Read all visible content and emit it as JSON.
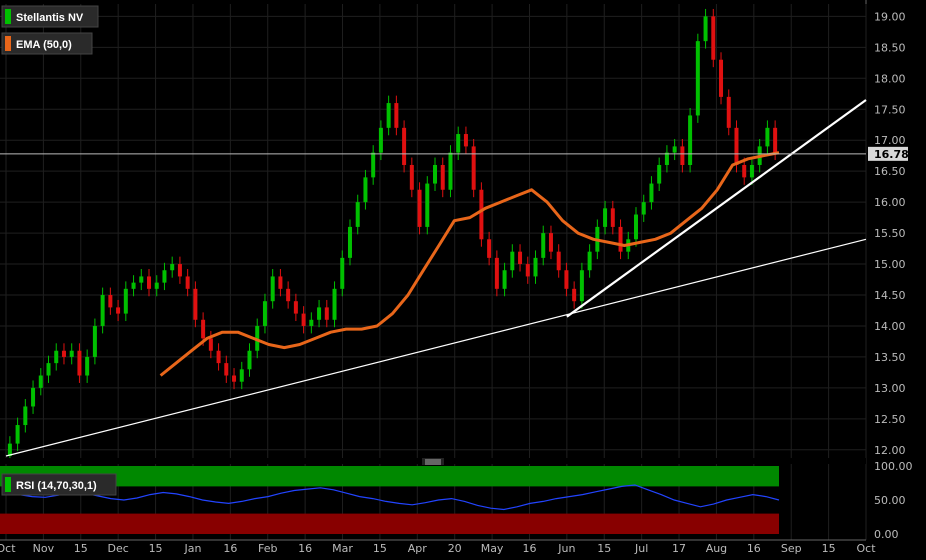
{
  "legend": {
    "symbol": "Stellantis NV",
    "symbol_color": "#00c000",
    "ema": "EMA (50,0)",
    "ema_color": "#e8661a",
    "rsi": "RSI (14,70,30,1)",
    "rsi_color": "#00c000"
  },
  "last_price_label": "16.78",
  "colors": {
    "up": "#00c000",
    "down": "#e01010",
    "ema": "#e8661a",
    "rsi_line": "#2244ff",
    "rsi_over": "#008800",
    "rsi_under": "#880000",
    "trend": "#ffffff"
  },
  "x_labels": [
    "Oct",
    "Nov",
    "15",
    "Dec",
    "15",
    "Jan",
    "16",
    "Feb",
    "16",
    "Mar",
    "15",
    "Apr",
    "20",
    "May",
    "16",
    "Jun",
    "15",
    "Jul",
    "17",
    "Aug",
    "16",
    "Sep",
    "15",
    "Oct"
  ],
  "price_ticks": [
    "19.00",
    "18.50",
    "18.00",
    "17.50",
    "17.00",
    "16.50",
    "16.00",
    "15.50",
    "15.00",
    "14.50",
    "14.00",
    "13.50",
    "13.00",
    "12.50",
    "12.00"
  ],
  "rsi_ticks": [
    "100.00",
    "50.00",
    "0.00"
  ],
  "chart_data": {
    "type": "candlestick",
    "title": "Stellantis NV",
    "ylim": [
      11.9,
      19.2
    ],
    "rsi_ylim": [
      0,
      100
    ],
    "rsi_bands": {
      "overbought": 70,
      "oversold": 30
    },
    "last_price": 16.78,
    "closes": [
      12.1,
      12.4,
      12.7,
      13.0,
      13.2,
      13.4,
      13.6,
      13.5,
      13.6,
      13.2,
      13.5,
      14.0,
      14.5,
      14.3,
      14.2,
      14.6,
      14.7,
      14.8,
      14.6,
      14.7,
      14.9,
      15.0,
      14.8,
      14.6,
      14.1,
      13.8,
      13.6,
      13.4,
      13.2,
      13.1,
      13.3,
      13.6,
      14.0,
      14.4,
      14.8,
      14.6,
      14.4,
      14.2,
      14.0,
      14.1,
      14.3,
      14.1,
      14.6,
      15.1,
      15.6,
      16.0,
      16.4,
      16.8,
      17.2,
      17.6,
      17.2,
      16.6,
      16.2,
      15.6,
      16.3,
      16.6,
      16.2,
      16.8,
      17.1,
      16.9,
      16.2,
      15.4,
      15.1,
      14.6,
      14.9,
      15.2,
      15.0,
      14.8,
      15.1,
      15.5,
      15.2,
      14.9,
      14.6,
      14.4,
      14.9,
      15.2,
      15.6,
      15.9,
      15.6,
      15.2,
      15.4,
      15.8,
      16.0,
      16.3,
      16.6,
      16.8,
      16.9,
      16.6,
      17.4,
      18.6,
      19.0,
      18.3,
      17.7,
      17.2,
      16.6,
      16.4,
      16.6,
      16.9,
      17.2,
      16.8
    ],
    "ema50": [
      null,
      null,
      null,
      null,
      null,
      null,
      null,
      null,
      null,
      null,
      13.2,
      13.4,
      13.6,
      13.8,
      13.9,
      13.9,
      13.8,
      13.7,
      13.65,
      13.7,
      13.8,
      13.9,
      13.95,
      13.95,
      14.0,
      14.2,
      14.5,
      14.9,
      15.3,
      15.7,
      15.75,
      15.9,
      16.0,
      16.1,
      16.2,
      16.0,
      15.7,
      15.5,
      15.4,
      15.35,
      15.3,
      15.35,
      15.4,
      15.5,
      15.7,
      15.9,
      16.2,
      16.6,
      16.7,
      16.75,
      16.8
    ],
    "trendlines": [
      {
        "from": [
          "Oct",
          11.9
        ],
        "to": [
          "Oct",
          15.4
        ]
      },
      {
        "from": [
          "Jun",
          14.15
        ],
        "to": [
          "Oct",
          17.65
        ]
      }
    ],
    "rsi": [
      60,
      58,
      55,
      54,
      57,
      62,
      60,
      56,
      52,
      50,
      53,
      58,
      61,
      59,
      55,
      50,
      47,
      45,
      48,
      52,
      55,
      60,
      64,
      66,
      68,
      65,
      60,
      55,
      52,
      48,
      45,
      43,
      46,
      50,
      52,
      48,
      42,
      38,
      36,
      40,
      45,
      48,
      52,
      55,
      58,
      62,
      66,
      70,
      72,
      65,
      58,
      50,
      45,
      40,
      44,
      50,
      54,
      58,
      55,
      50
    ]
  }
}
